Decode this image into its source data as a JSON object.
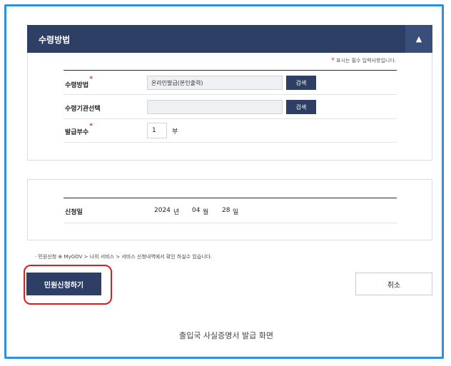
{
  "section1": {
    "title": "수령방법",
    "collapse_icon": "▲",
    "required_note_star": "*",
    "required_note": "표시는 필수 입력사항입니다.",
    "rows": {
      "method": {
        "label": "수령방법",
        "value": "온라인발급(본인출력)",
        "button": "검색"
      },
      "agency": {
        "label": "수령기관선택",
        "value": "",
        "button": "검색"
      },
      "copies": {
        "label": "발급부수",
        "value": "1",
        "unit": "부"
      }
    }
  },
  "section2": {
    "date_label": "신청일",
    "year": "2024",
    "year_unit": "년",
    "month": "04",
    "month_unit": "월",
    "day": "28",
    "day_unit": "일"
  },
  "notice": "· 민원신청 ⊕ MyGOV > 나의 서비스 > 서비스 신청내역에서 확인 하실수 있습니다.",
  "actions": {
    "apply": "민원신청하기",
    "cancel": "취소"
  },
  "caption": "출입국 사실증명서 발급 화면",
  "colors": {
    "header": "#2e3f66",
    "frame": "#2f8fe0",
    "highlight": "#e01c1c",
    "required": "#d32f2f"
  }
}
